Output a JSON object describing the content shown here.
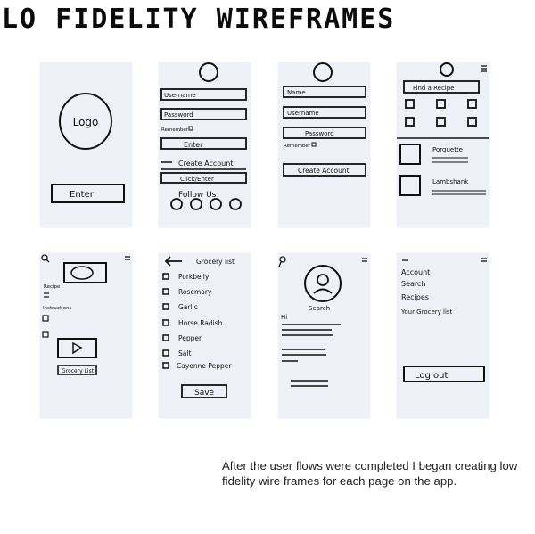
{
  "title": "LO FIDELITY WIREFRAMES",
  "description": "After the user flows were completed I began creating low fidelity wire frames for each page on the app.",
  "colors": {
    "background": "#ffffff",
    "frame": "#eef1f7",
    "ink": "#111111"
  },
  "frames": {
    "splash": {
      "logo": "Logo",
      "button": "Enter"
    },
    "login": {
      "fields": [
        "Username",
        "Password"
      ],
      "remember": "Remember",
      "enter": "Enter",
      "create": "Create Account",
      "clickhere": "Click/Enter",
      "follow": "Follow Us"
    },
    "signup": {
      "fields": [
        "Name",
        "Username",
        "Password"
      ],
      "remember": "Remember",
      "create": "Create Account"
    },
    "home": {
      "search": "Find a Recipe",
      "items": [
        "Porquette",
        "Lambshank"
      ]
    },
    "recipe": {
      "labels": [
        "Recipe",
        "Instructions"
      ],
      "button": "Grocery List"
    },
    "grocery": {
      "title": "Grocery list",
      "items": [
        "Porkbelly",
        "Rosemary",
        "Garlic",
        "Horse Radish",
        "Pepper",
        "Salt",
        "Cayenne Pepper"
      ],
      "save": "Save"
    },
    "profile": {
      "search": "Search",
      "greeting": "Hi"
    },
    "menu": {
      "items": [
        "Account",
        "Search",
        "Recipes",
        "Your Grocery list"
      ],
      "logout": "Log out"
    }
  },
  "icons": [
    "search-icon",
    "hamburger-menu-icon",
    "back-arrow-icon",
    "play-icon",
    "avatar-icon",
    "checkbox-icon"
  ]
}
